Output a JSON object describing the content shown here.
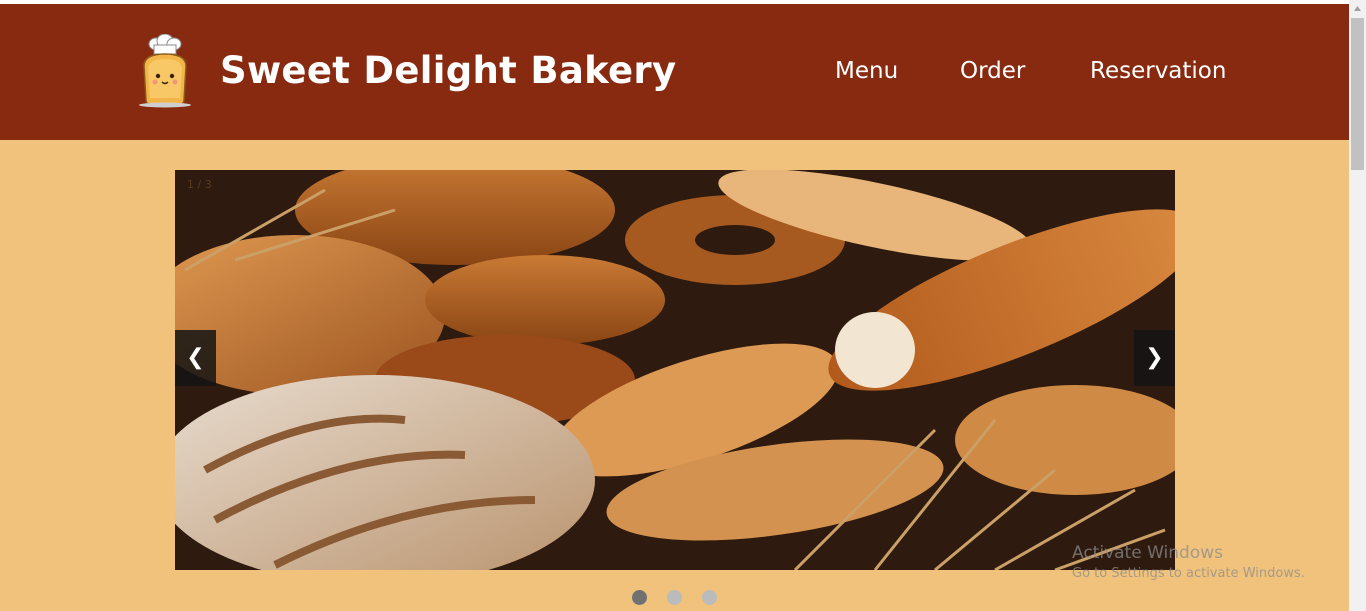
{
  "header": {
    "logo_icon": "chef-toast-logo-icon",
    "title": "Sweet Delight Bakery",
    "nav": [
      {
        "label": "Menu"
      },
      {
        "label": "Order"
      },
      {
        "label": "Reservation"
      }
    ]
  },
  "slideshow": {
    "counter": "1 / 3",
    "prev_label": "❮",
    "next_label": "❯",
    "image_icon": "bread-loaves-photo",
    "total_slides": 3,
    "active_slide": 1
  },
  "watermark": {
    "title": "Activate Windows",
    "subtitle": "Go to Settings to activate Windows."
  },
  "colors": {
    "header_bg": "#882a10",
    "page_bg": "#f0c27b",
    "dot_active": "#717171",
    "dot_inactive": "#bbbbbb"
  }
}
